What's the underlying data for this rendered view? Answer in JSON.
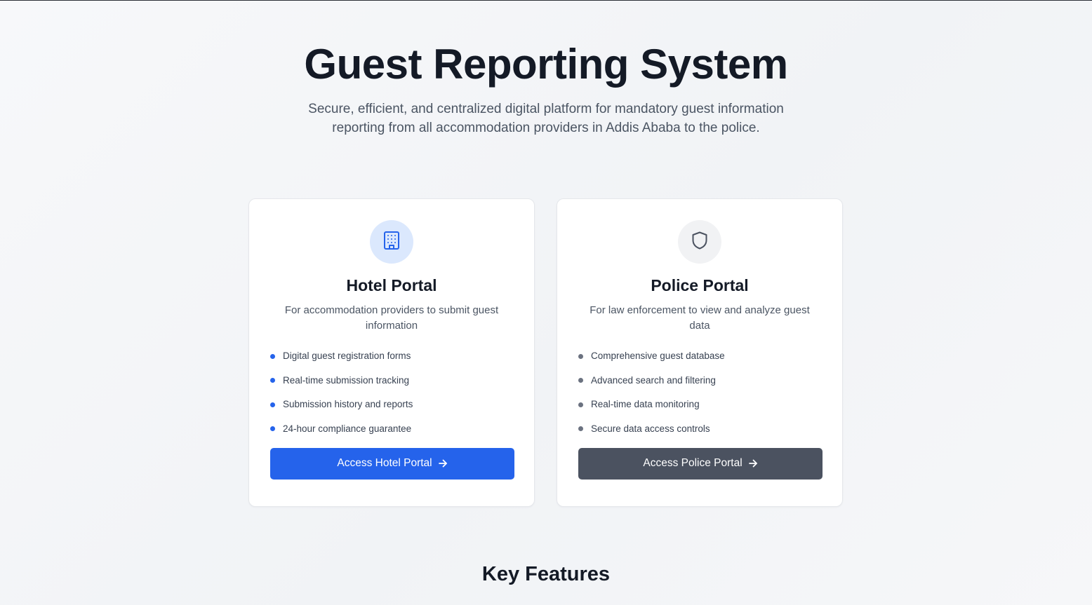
{
  "hero": {
    "title": "Guest Reporting System",
    "subtitle": "Secure, efficient, and centralized digital platform for mandatory guest information reporting from all accommodation providers in Addis Ababa to the police."
  },
  "hotel_card": {
    "icon": "building-icon",
    "title": "Hotel Portal",
    "description": "For accommodation providers to submit guest information",
    "features": [
      "Digital guest registration forms",
      "Real-time submission tracking",
      "Submission history and reports",
      "24-hour compliance guarantee"
    ],
    "button_label": "Access Hotel Portal",
    "accent": "#2563eb"
  },
  "police_card": {
    "icon": "shield-icon",
    "title": "Police Portal",
    "description": "For law enforcement to view and analyze guest data",
    "features": [
      "Comprehensive guest database",
      "Advanced search and filtering",
      "Real-time data monitoring",
      "Secure data access controls"
    ],
    "button_label": "Access Police Portal",
    "accent": "#4b5260"
  },
  "key_features": {
    "heading": "Key Features"
  }
}
